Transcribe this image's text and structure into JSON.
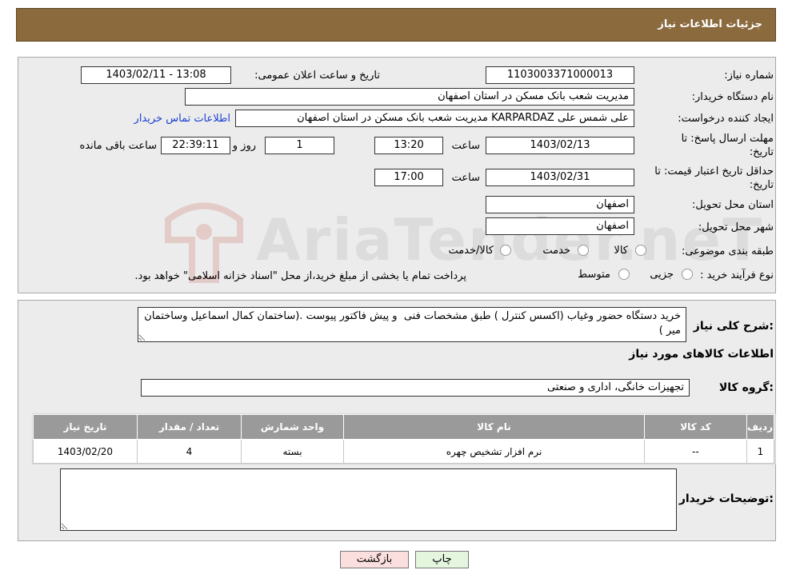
{
  "header": {
    "title": "جزئیات اطلاعات نیاز"
  },
  "form": {
    "need_number_label": "شماره نیاز:",
    "need_number": "1103003371000013",
    "announce_label": "تاریخ و ساعت اعلان عمومی:",
    "announce_value": "1403/02/11 - 13:08",
    "buyer_label": "نام دستگاه خریدار:",
    "buyer_value": "مدیریت شعب بانک مسکن در استان اصفهان",
    "creator_label": "ایجاد کننده درخواست:",
    "creator_value": "علی شمس علی KARPARDAZ مدیریت شعب بانک مسکن در استان اصفهان",
    "contact_link": "اطلاعات تماس خریدار",
    "deadline_label_1": "مهلت ارسال پاسخ: تا",
    "deadline_label_2": "تاریخ:",
    "deadline_date": "1403/02/13",
    "time_label": "ساعت",
    "deadline_time": "13:20",
    "days_value": "1",
    "days_label": "روز و",
    "remaining_time": "22:39:11",
    "remaining_label": "ساعت باقی مانده",
    "validity_label_1": "حداقل تاریخ اعتبار قیمت: تا",
    "validity_label_2": "تاریخ:",
    "validity_date": "1403/02/31",
    "validity_time": "17:00",
    "province_label": "استان محل تحویل:",
    "province_value": "اصفهان",
    "city_label": "شهر محل تحویل:",
    "city_value": "اصفهان",
    "category_label": "طبقه بندی موضوعی:",
    "category_options": [
      "کالا",
      "خدمت",
      "کالا/خدمت"
    ],
    "process_label": "نوع فرآیند خرید :",
    "process_options": [
      "جزیی",
      "متوسط"
    ],
    "payment_note": "پرداخت تمام یا بخشی از مبلغ خرید،از محل \"اسناد خزانه اسلامی\" خواهد بود."
  },
  "details": {
    "description_label": "شرح کلی نیاز:",
    "description_value": "خرید دستگاه حضور وغیاب (اکسس کنترل ) طبق مشخصات فنی  و پیش فاکتور پیوست .(ساختمان کمال اسماعیل وساختمان میر )",
    "goods_info_title": "اطلاعات کالاهای مورد نیاز",
    "goods_group_label": "گروه کالا:",
    "goods_group_value": "تجهیزات خانگی، اداری و صنعتی",
    "table": {
      "headers": [
        "ردیف",
        "کد کالا",
        "نام کالا",
        "واحد شمارش",
        "تعداد / مقدار",
        "تاریخ نیاز"
      ],
      "rows": [
        [
          "1",
          "--",
          "نرم افزار تشخیص چهره",
          "بسته",
          "4",
          "1403/02/20"
        ]
      ]
    },
    "buyer_notes_label": "توضیحات خریدار:",
    "buyer_notes_value": ""
  },
  "buttons": {
    "print": "چاپ",
    "back": "بازگشت"
  },
  "watermark": {
    "text": "AriaTender.neT"
  },
  "colors": {
    "header_bg": "#8b6a3e",
    "table_header_bg": "#9a9a9a",
    "link": "#1a3fd1"
  }
}
